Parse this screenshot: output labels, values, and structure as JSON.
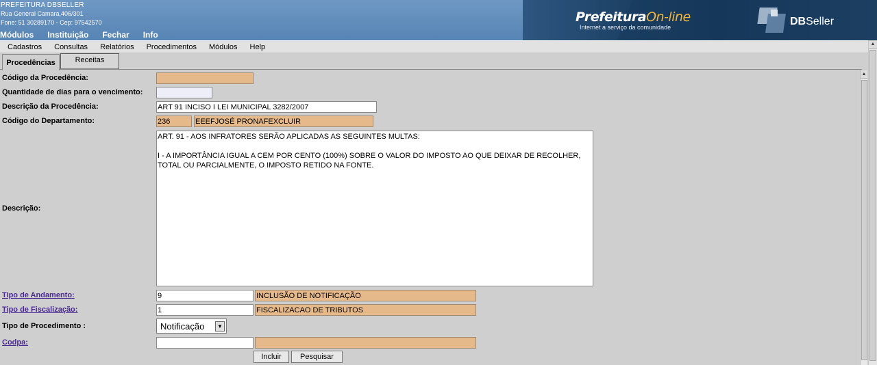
{
  "header": {
    "org_name": "PREFEITURA DBSELLER",
    "address": "Rua General Camara,406/301",
    "phone": "Fone: 51 30289170  -  Cep: 97542570",
    "top_menu": [
      "Módulos",
      "Instituição",
      "Fechar",
      "Info"
    ],
    "brand_main": "Prefeitura",
    "brand_online": "On-line",
    "brand_tagline": "Internet a serviço da comunidade",
    "db_logo_bold": "DB",
    "db_logo_rest": "Seller"
  },
  "menubar": [
    "Cadastros",
    "Consultas",
    "Relatórios",
    "Procedimentos",
    "Módulos",
    "Help"
  ],
  "tabs": [
    {
      "label": "Procedências",
      "active": true
    },
    {
      "label": "Receitas",
      "active": false
    }
  ],
  "form": {
    "codigo_procedencia": {
      "label": "Código da Procedência:",
      "value": ""
    },
    "qtd_dias": {
      "label": "Quantidade de dias para o vencimento:",
      "value": ""
    },
    "descricao_procedencia": {
      "label": "Descrição da Procedência:",
      "value": "ART 91 INCISO I LEI MUNICIPAL 3282/2007"
    },
    "codigo_departamento": {
      "label": "Código do Departamento:",
      "code": "236",
      "name": "EEEFJOSÉ PRONAFEXCLUIR"
    },
    "descricao": {
      "label": "Descrição:",
      "text": "ART. 91 - AOS INFRATORES SERÃO APLICADAS AS SEGUINTES MULTAS:\n\nI - A IMPORTÂNCIA IGUAL A CEM POR CENTO (100%) SOBRE O VALOR DO IMPOSTO AO QUE DEIXAR DE RECOLHER, TOTAL OU PARCIALMENTE, O IMPOSTO RETIDO NA FONTE."
    },
    "tipo_andamento": {
      "label": "Tipo de Andamento:",
      "code": "9",
      "name": "INCLUSÃO DE NOTIFICAÇÃO"
    },
    "tipo_fiscalizacao": {
      "label": "Tipo de Fiscalização:",
      "code": "1",
      "name": "FISCALIZACAO DE TRIBUTOS"
    },
    "tipo_procedimento": {
      "label": "Tipo de Procedimento :",
      "selected": "Notificação"
    },
    "codpa": {
      "label": "Codpa:",
      "code": "",
      "name": ""
    }
  },
  "buttons": {
    "incluir": "Incluir",
    "pesquisar": "Pesquisar"
  },
  "colors": {
    "readonly_field": "#e6b98a",
    "header_blue": "#5f8dbd",
    "link": "#4a2a8f"
  }
}
